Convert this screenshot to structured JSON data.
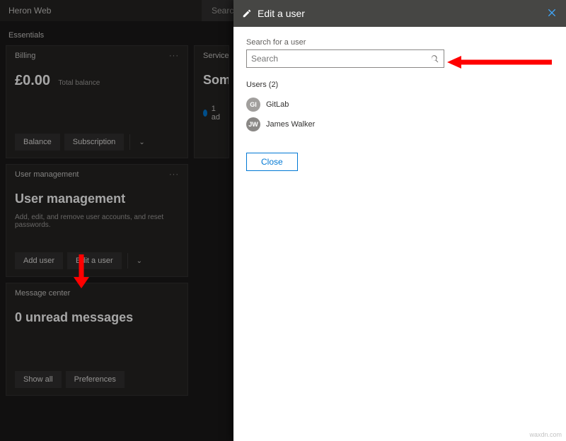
{
  "topbar": {
    "title": "Heron Web",
    "search_label": "Search"
  },
  "essentials_label": "Essentials",
  "billing": {
    "header": "Billing",
    "amount": "£0.00",
    "sub": "Total balance",
    "balance_btn": "Balance",
    "subscription_btn": "Subscription"
  },
  "service": {
    "header": "Service health",
    "title": "Some",
    "line": "1 ad"
  },
  "usermgmt": {
    "header": "User management",
    "title": "User management",
    "desc": "Add, edit, and remove user accounts, and reset passwords.",
    "add_btn": "Add user",
    "edit_btn": "Edit a user"
  },
  "msgcenter": {
    "header": "Message center",
    "title": "0 unread messages",
    "showall_btn": "Show all",
    "prefs_btn": "Preferences"
  },
  "panel": {
    "title": "Edit a user",
    "search_label": "Search for a user",
    "search_placeholder": "Search",
    "users_header": "Users (2)",
    "users": [
      {
        "initials": "GI",
        "name": "GitLab"
      },
      {
        "initials": "JW",
        "name": "James Walker"
      }
    ],
    "close_btn": "Close"
  },
  "watermark": "waxdn.com"
}
